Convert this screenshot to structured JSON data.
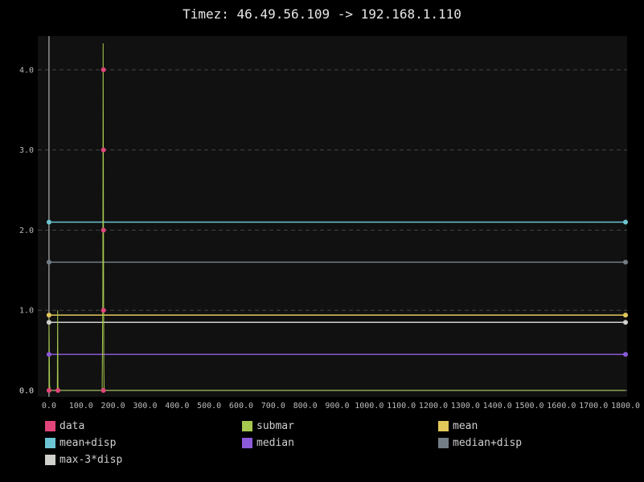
{
  "chart_data": {
    "type": "line",
    "title": "Timez: 46.49.56.109 -> 192.168.1.110",
    "xlabel": "",
    "ylabel": "",
    "xlim": [
      -35,
      1805
    ],
    "ylim": [
      -0.08,
      4.42
    ],
    "x_ticks": [
      "0.0",
      "100.0",
      "200.0",
      "300.0",
      "400.0",
      "500.0",
      "600.0",
      "700.0",
      "800.0",
      "900.0",
      "1000.0",
      "1100.0",
      "1200.0",
      "1300.0",
      "1400.0",
      "1500.0",
      "1600.0",
      "1700.0",
      "1800.0"
    ],
    "x_tick_values": [
      0,
      100,
      200,
      300,
      400,
      500,
      600,
      700,
      800,
      900,
      1000,
      1100,
      1200,
      1300,
      1400,
      1500,
      1600,
      1700,
      1800
    ],
    "y_ticks": [
      "0.0",
      "0.0",
      "1.0",
      "2.0",
      "3.0",
      "4.0"
    ],
    "y_tick_values": [
      0,
      0,
      1,
      2,
      3,
      4
    ],
    "grid": true,
    "legend_position": "bottom",
    "colors": {
      "background": "#000000",
      "plot_background": "#111111",
      "grid": "#444444",
      "axis_text": "#bbbbbb"
    },
    "series": [
      {
        "name": "data",
        "color": "#e2457a",
        "kind": "points",
        "points": [
          [
            0,
            0
          ],
          [
            28,
            0
          ],
          [
            170,
            4
          ],
          [
            170,
            3
          ],
          [
            170,
            2
          ],
          [
            170,
            1
          ],
          [
            170,
            0
          ]
        ]
      },
      {
        "name": "submar",
        "color": "#a5c84f",
        "kind": "line",
        "points": [
          [
            0,
            0
          ],
          [
            0,
            0.9
          ],
          [
            2,
            0.05
          ],
          [
            5,
            0
          ],
          [
            26,
            0
          ],
          [
            27,
            1.0
          ],
          [
            28,
            0.05
          ],
          [
            30,
            0
          ],
          [
            166,
            0
          ],
          [
            168,
            1.2
          ],
          [
            168.5,
            2.6
          ],
          [
            169,
            4.33
          ],
          [
            169.5,
            3.3
          ],
          [
            170,
            2.2
          ],
          [
            170.5,
            1.3
          ],
          [
            171,
            0.4
          ],
          [
            172,
            0
          ],
          [
            1800,
            0
          ]
        ]
      },
      {
        "name": "mean",
        "color": "#e2c75a",
        "kind": "line",
        "points": [
          [
            0,
            0.94
          ],
          [
            1800,
            0.94
          ]
        ]
      },
      {
        "name": "mean+disp",
        "color": "#6cc5d2",
        "kind": "line",
        "points": [
          [
            0,
            2.1
          ],
          [
            1800,
            2.1
          ]
        ]
      },
      {
        "name": "median",
        "color": "#8a5ad8",
        "kind": "line",
        "points": [
          [
            0,
            0.45
          ],
          [
            1800,
            0.45
          ]
        ]
      },
      {
        "name": "median+disp",
        "color": "#737d86",
        "kind": "line",
        "points": [
          [
            0,
            1.6
          ],
          [
            1800,
            1.6
          ]
        ]
      },
      {
        "name": "max-3*disp",
        "color": "#d0d0cc",
        "kind": "line",
        "points": [
          [
            0,
            0.85
          ],
          [
            1800,
            0.85
          ]
        ]
      }
    ]
  }
}
